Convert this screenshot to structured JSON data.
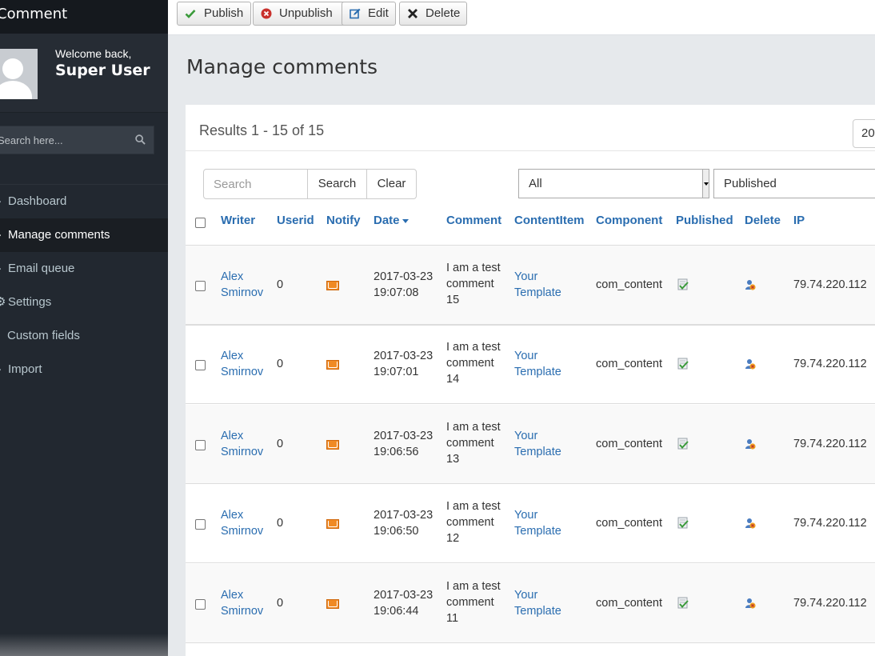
{
  "app": {
    "brand": "Comment"
  },
  "user": {
    "welcome": "Welcome back,",
    "name": "Super User"
  },
  "sidebar": {
    "search_placeholder": "Search here...",
    "items": [
      {
        "label": "Dashboard",
        "icon": "dashboard-icon"
      },
      {
        "label": "Manage comments",
        "icon": "comments-icon",
        "active": true
      },
      {
        "label": "Email queue",
        "icon": "envelope-icon"
      },
      {
        "label": "Settings",
        "icon": "settings-icon"
      },
      {
        "label": "Custom fields",
        "icon": "list-icon"
      },
      {
        "label": "Import",
        "icon": "import-icon"
      }
    ]
  },
  "toolbar": {
    "publish": "Publish",
    "unpublish": "Unpublish",
    "edit": "Edit",
    "delete": "Delete"
  },
  "page": {
    "title": "Manage comments",
    "results": "Results 1 - 15 of 15",
    "limit": "20"
  },
  "filters": {
    "search_placeholder": "Search",
    "search_button": "Search",
    "clear_button": "Clear",
    "component_select": "All",
    "state_select": "Published"
  },
  "table": {
    "headers": {
      "writer": "Writer",
      "userid": "Userid",
      "notify": "Notify",
      "date": "Date",
      "comment": "Comment",
      "contentitem": "ContentItem",
      "component": "Component",
      "published": "Published",
      "delete": "Delete",
      "ip": "IP"
    },
    "rows": [
      {
        "writer_first": "Alex",
        "writer_last": "Smirnov",
        "userid": "0",
        "date": "2017-03-23",
        "time": "19:07:08",
        "c1": "I am a test",
        "c2": "comment",
        "c3": "15",
        "item1": "Your",
        "item2": "Template",
        "component": "com_content",
        "ip": "79.74.220.112"
      },
      {
        "writer_first": "Alex",
        "writer_last": "Smirnov",
        "userid": "0",
        "date": "2017-03-23",
        "time": "19:07:01",
        "c1": "I am a test",
        "c2": "comment",
        "c3": "14",
        "item1": "Your",
        "item2": "Template",
        "component": "com_content",
        "ip": "79.74.220.112"
      },
      {
        "writer_first": "Alex",
        "writer_last": "Smirnov",
        "userid": "0",
        "date": "2017-03-23",
        "time": "19:06:56",
        "c1": "I am a test",
        "c2": "comment",
        "c3": "13",
        "item1": "Your",
        "item2": "Template",
        "component": "com_content",
        "ip": "79.74.220.112"
      },
      {
        "writer_first": "Alex",
        "writer_last": "Smirnov",
        "userid": "0",
        "date": "2017-03-23",
        "time": "19:06:50",
        "c1": "I am a test",
        "c2": "comment",
        "c3": "12",
        "item1": "Your",
        "item2": "Template",
        "component": "com_content",
        "ip": "79.74.220.112"
      },
      {
        "writer_first": "Alex",
        "writer_last": "Smirnov",
        "userid": "0",
        "date": "2017-03-23",
        "time": "19:06:44",
        "c1": "I am a test",
        "c2": "comment",
        "c3": "11",
        "item1": "Your",
        "item2": "Template",
        "component": "com_content",
        "ip": "79.74.220.112"
      }
    ]
  },
  "colors": {
    "sidebar": "#222830",
    "link": "#2a6db0",
    "notify": "#f08a24"
  }
}
